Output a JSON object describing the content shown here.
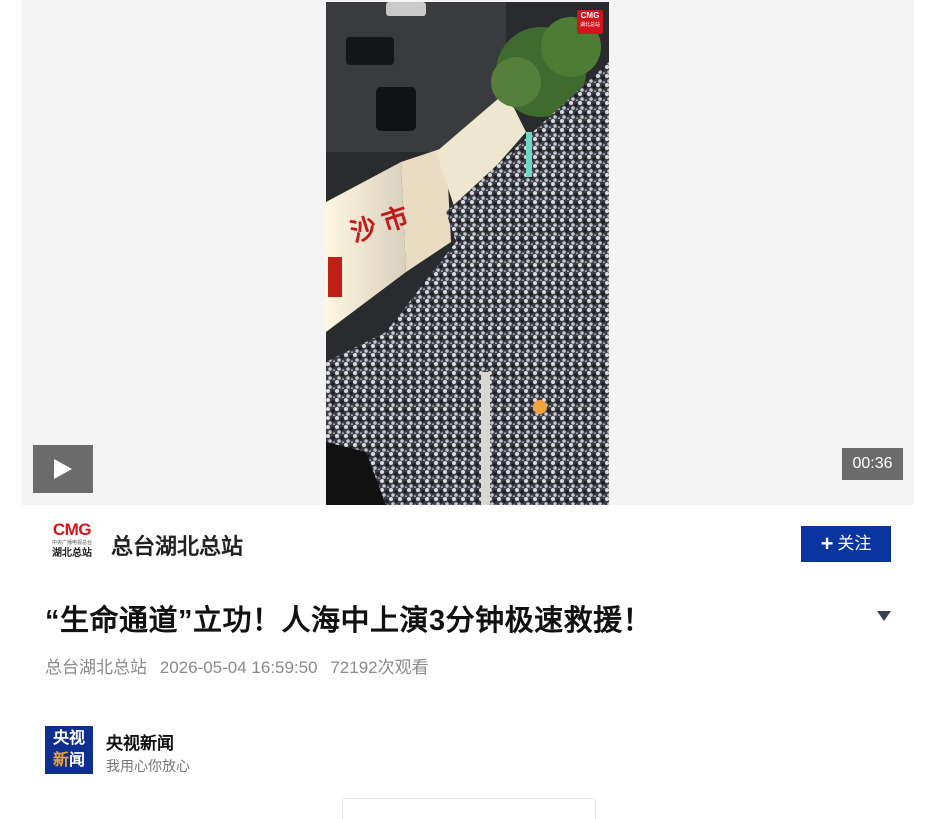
{
  "player": {
    "duration": "00:36",
    "play_label": "play",
    "watermark_brand": "CMG",
    "watermark_sub": "湖北总站"
  },
  "author": {
    "logo_text": "CMG",
    "logo_fullname": "中央广播电视总台",
    "logo_station": "湖北总站",
    "name": "总台湖北总站",
    "follow_label": "关注",
    "follow_icon": "plus-icon"
  },
  "article": {
    "title": "“生命通道”立功！人海中上演3分钟极速救援！",
    "source": "总台湖北总站",
    "timestamp": "2026-05-04 16:59:50",
    "views": "72192次观看"
  },
  "channel": {
    "logo_line1": "央视",
    "logo_line2a": "新",
    "logo_line2b": "闻",
    "name": "央视新闻",
    "slogan": "我用心你放心"
  },
  "colors": {
    "follow_bg": "#0a34a0",
    "cmg_red": "#d2141e",
    "overlay_gray": "#6b6b6b",
    "channel_blue": "#0f2f8f"
  }
}
